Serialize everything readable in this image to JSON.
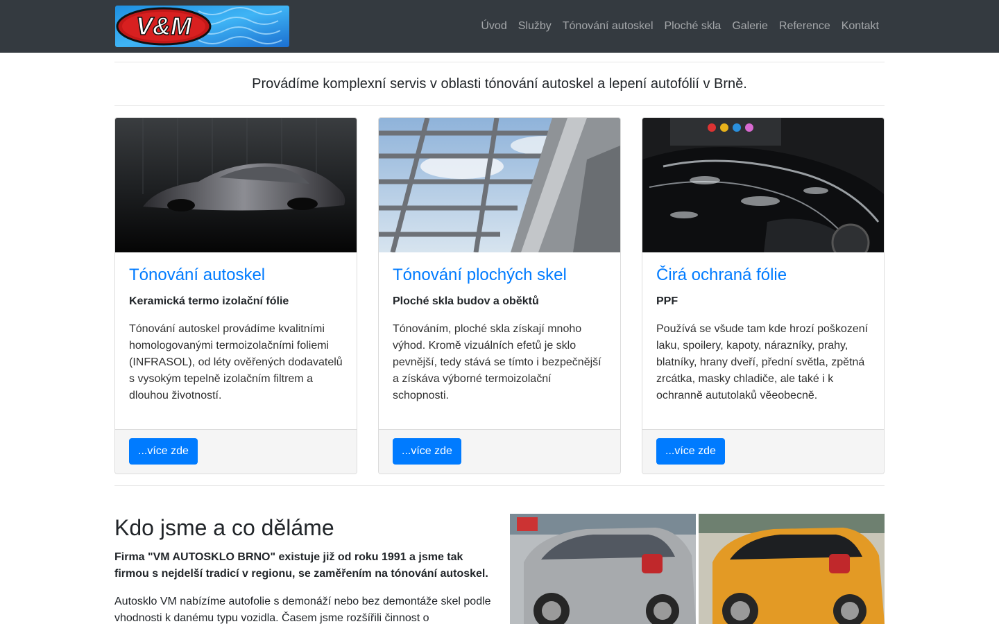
{
  "brand": {
    "logo_text": "V&M"
  },
  "nav": {
    "items": [
      "Úvod",
      "Služby",
      "Tónování autoskel",
      "Ploché skla",
      "Galerie",
      "Reference",
      "Kontakt"
    ]
  },
  "lead": "Provádíme komplexní servis v oblasti tónování autoskel a lepení autofólií v Brně.",
  "cards": [
    {
      "title": "Tónování autoskel",
      "subtitle": "Keramická termo izolační fólie",
      "text": "Tónování autoskel provádíme kvalitními homologovanými termoizolačními foliemi (INFRASOL), od léty ověřených dodavatelů s vysokým tepelně izolačním filtrem a dlouhou životností.",
      "button": "...více zde"
    },
    {
      "title": "Tónování plochých skel",
      "subtitle": "Ploché skla budov a oběktů",
      "text": "Tónováním, ploché skla získají mnoho výhod. Kromě vizuálních efetů je sklo pevnější, tedy stává se tímto i bezpečnější a získáva výborné termoizolační schopnosti.",
      "button": "...více zde"
    },
    {
      "title": "Čirá ochraná fólie",
      "subtitle": "PPF",
      "text": "Používá se všude tam kde hrozí poškození laku, spoilery, kapoty, nárazníky, prahy, blatníky, hrany dveří, přední světla, zpětná zrcátka, masky chladiče, ale také i k ochranně aututolaků věeobecně.",
      "button": "...více zde"
    }
  ],
  "about": {
    "heading": "Kdo jsme a co děláme",
    "strong": "Firma \"VM AUTOSKLO BRNO\" existuje již od roku 1991 a jsme tak firmou s nejdelší tradicí v regionu, se zaměřením na tónování autoskel.",
    "text": "Autosklo VM nabízíme autofolie s demonáží nebo bez demontáže skel podle vhodnosti k danému typu vozidla. Časem jsme rozšířili činnost o"
  },
  "colors": {
    "navbar": "#343a40",
    "accent": "#007bff"
  }
}
